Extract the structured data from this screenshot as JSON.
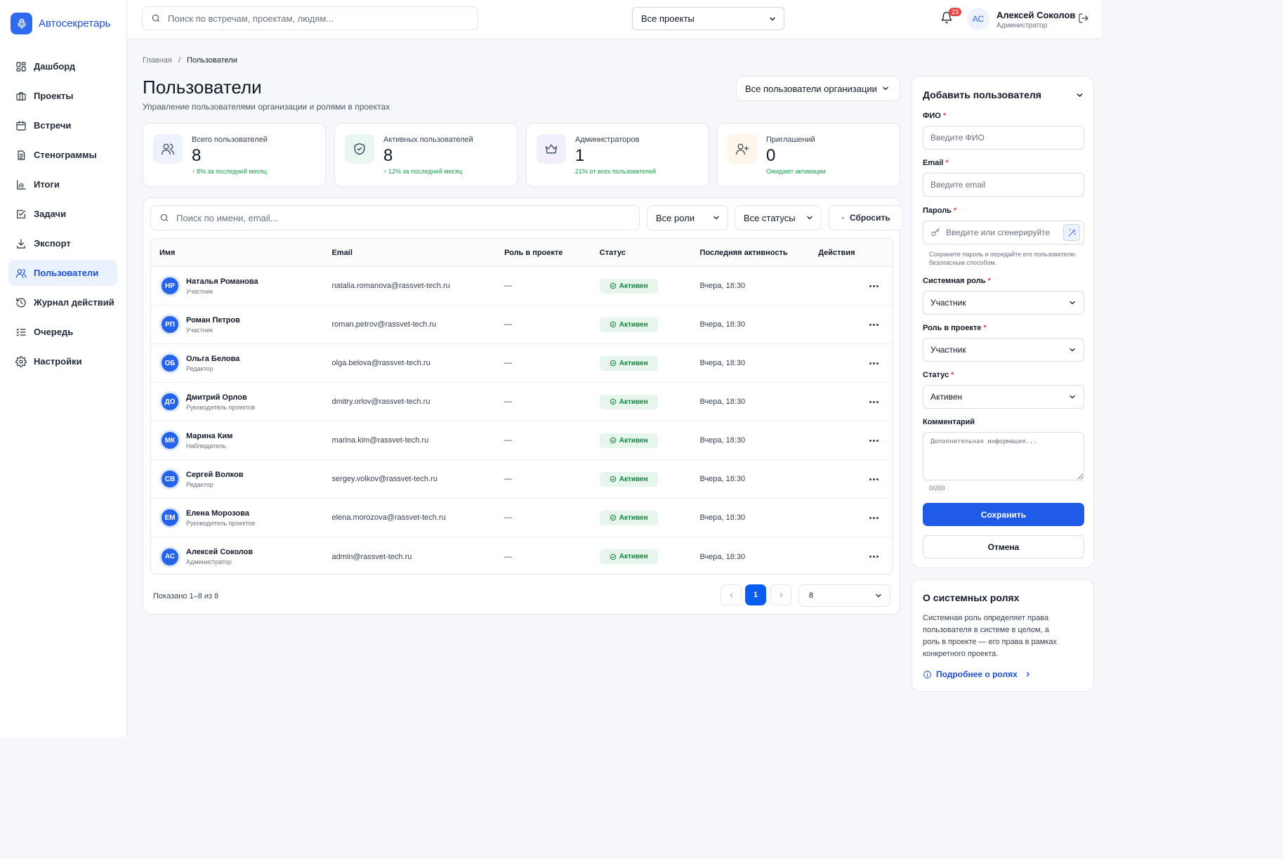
{
  "app": {
    "name": "Автосекретарь",
    "brand_color": "#2f6bf0"
  },
  "sidebar": {
    "items": [
      {
        "label": "Дашборд",
        "icon": "grid-icon"
      },
      {
        "label": "Проекты",
        "icon": "briefcase-icon"
      },
      {
        "label": "Встречи",
        "icon": "calendar-icon"
      },
      {
        "label": "Стенограммы",
        "icon": "document-icon"
      },
      {
        "label": "Итоги",
        "icon": "bar-chart-icon"
      },
      {
        "label": "Задачи",
        "icon": "checkbox-icon"
      },
      {
        "label": "Экспорт",
        "icon": "download-icon"
      },
      {
        "label": "Пользователи",
        "icon": "users-icon",
        "active": true
      },
      {
        "label": "Журнал действий",
        "icon": "history-icon"
      },
      {
        "label": "Очередь",
        "icon": "list-check-icon"
      },
      {
        "label": "Настройки",
        "icon": "gear-icon"
      }
    ]
  },
  "header": {
    "search_placeholder": "Поиск по встречам, проектам, людям...",
    "project_select": "Все проекты",
    "notifications_count": "23",
    "user": {
      "initials": "АС",
      "name": "Алексей Соколов",
      "role": "Администратор"
    }
  },
  "breadcrumb": {
    "home": "Главная",
    "separator": "/",
    "current": "Пользователи"
  },
  "page": {
    "title": "Пользователи",
    "subtitle": "Управление пользователями организации и ролями в проектах",
    "scope_select": "Все пользователи организации"
  },
  "stats": [
    {
      "label": "Всего пользователей",
      "value": "8",
      "note": "↑ 8% за последний месяц",
      "icon": "users-icon",
      "icon_bg": "#eef2ff",
      "icon_color": "#4b5563"
    },
    {
      "label": "Активных пользователей",
      "value": "8",
      "note": "↑ 12% за последний месяц",
      "icon": "shield-check-icon",
      "icon_bg": "#eaf7f0",
      "icon_color": "#374151"
    },
    {
      "label": "Администраторов",
      "value": "1",
      "note": "21% от всех пользователей",
      "icon": "crown-icon",
      "icon_bg": "#f3eefe",
      "icon_color": "#4b5563"
    },
    {
      "label": "Приглашений",
      "value": "0",
      "note": "Ожидают активации",
      "icon": "user-plus-icon",
      "icon_bg": "#fff5e8",
      "icon_color": "#4b5563"
    }
  ],
  "filters": {
    "search_placeholder": "Поиск по имени, email...",
    "role": "Все роли",
    "status": "Все статусы",
    "reset": "Сбросить"
  },
  "table": {
    "columns": [
      "Имя",
      "Email",
      "Роль в проекте",
      "Статус",
      "Последняя активность",
      "Действия"
    ],
    "rows": [
      {
        "initials": "НР",
        "name": "Наталья Романова",
        "role": "Участник",
        "email": "natalia.romanova@rassvet-tech.ru",
        "project_role": "—",
        "status": "Активен",
        "last": "Вчера, 18:30"
      },
      {
        "initials": "РП",
        "name": "Роман Петров",
        "role": "Участник",
        "email": "roman.petrov@rassvet-tech.ru",
        "project_role": "—",
        "status": "Активен",
        "last": "Вчера, 18:30"
      },
      {
        "initials": "ОБ",
        "name": "Ольга Белова",
        "role": "Редактор",
        "email": "olga.belova@rassvet-tech.ru",
        "project_role": "—",
        "status": "Активен",
        "last": "Вчера, 18:30"
      },
      {
        "initials": "ДО",
        "name": "Дмитрий Орлов",
        "role": "Руководитель проектов",
        "email": "dmitry.orlov@rassvet-tech.ru",
        "project_role": "—",
        "status": "Активен",
        "last": "Вчера, 18:30"
      },
      {
        "initials": "МК",
        "name": "Марина Ким",
        "role": "Наблюдатель",
        "email": "marina.kim@rassvet-tech.ru",
        "project_role": "—",
        "status": "Активен",
        "last": "Вчера, 18:30"
      },
      {
        "initials": "СВ",
        "name": "Сергей Волков",
        "role": "Редактор",
        "email": "sergey.volkov@rassvet-tech.ru",
        "project_role": "—",
        "status": "Активен",
        "last": "Вчера, 18:30"
      },
      {
        "initials": "ЕМ",
        "name": "Елена Морозова",
        "role": "Руководитель проектов",
        "email": "elena.morozova@rassvet-tech.ru",
        "project_role": "—",
        "status": "Активен",
        "last": "Вчера, 18:30"
      },
      {
        "initials": "АС",
        "name": "Алексей Соколов",
        "role": "Администратор",
        "email": "admin@rassvet-tech.ru",
        "project_role": "—",
        "status": "Активен",
        "last": "Вчера, 18:30"
      }
    ]
  },
  "pagination": {
    "shown": "Показано 1–8 из 8",
    "current_page": "1",
    "per_page": "8"
  },
  "add_user": {
    "title": "Добавить пользователя",
    "fio_label": "ФИО",
    "fio_placeholder": "Введите ФИО",
    "email_label": "Email",
    "email_placeholder": "Введите email",
    "password_label": "Пароль",
    "password_placeholder": "Введите или сгенерируйте",
    "password_hint": "Сохраните пароль и передайте его пользователю безопасным способом.",
    "system_role_label": "Системная роль",
    "system_role_value": "Участник",
    "project_role_label": "Роль в проекте",
    "project_role_value": "Участник",
    "status_label": "Статус",
    "status_value": "Активен",
    "comment_label": "Комментарий",
    "comment_placeholder": "Дополнительная информация...",
    "comment_counter": "0/200",
    "required_mark": "*",
    "save": "Сохранить",
    "cancel": "Отмена"
  },
  "roles_info": {
    "title": "О системных ролях",
    "text": "Системная роль определяет права пользователя в системе в целом, а роль в проекте — его права в рамках конкретного проекта.",
    "link": "Подробнее о ролях"
  },
  "colors": {
    "accent": "#1f5be6",
    "status_active_bg": "#e7f6ec",
    "status_active_text": "#15803d",
    "positive": "#16a34a",
    "badge_red": "#ef4444"
  }
}
